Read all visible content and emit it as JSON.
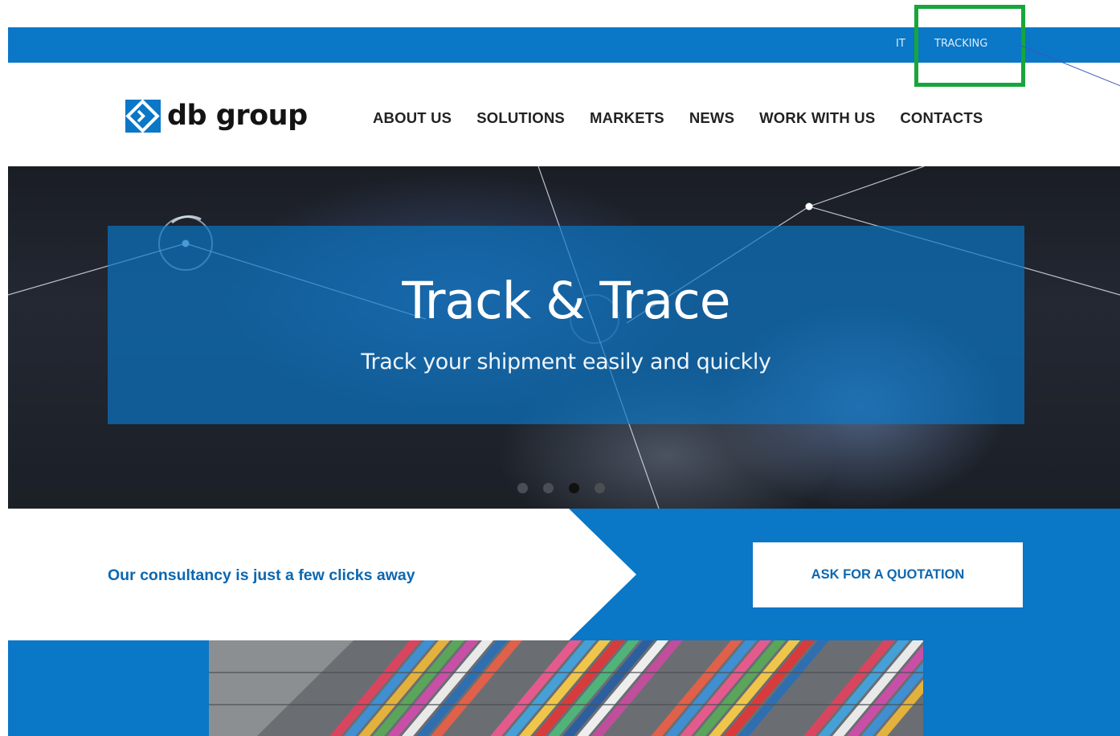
{
  "topbar": {
    "lang_label": "IT",
    "tracking_label": "TRACKING"
  },
  "brand": {
    "name": "db group",
    "color": "#0a77c7"
  },
  "nav": {
    "items": [
      {
        "label": "ABOUT US"
      },
      {
        "label": "SOLUTIONS"
      },
      {
        "label": "MARKETS"
      },
      {
        "label": "NEWS"
      },
      {
        "label": "WORK WITH US"
      },
      {
        "label": "CONTACTS"
      }
    ]
  },
  "hero": {
    "title": "Track & Trace",
    "subtitle": "Track your shipment easily and quickly",
    "slides": 4,
    "active_slide": 3
  },
  "cta": {
    "text": "Our consultancy is just a few clicks away",
    "button_label": "ASK FOR A QUOTATION"
  },
  "colors": {
    "primary_blue": "#0a77c7",
    "highlight_green": "#17a63a"
  }
}
